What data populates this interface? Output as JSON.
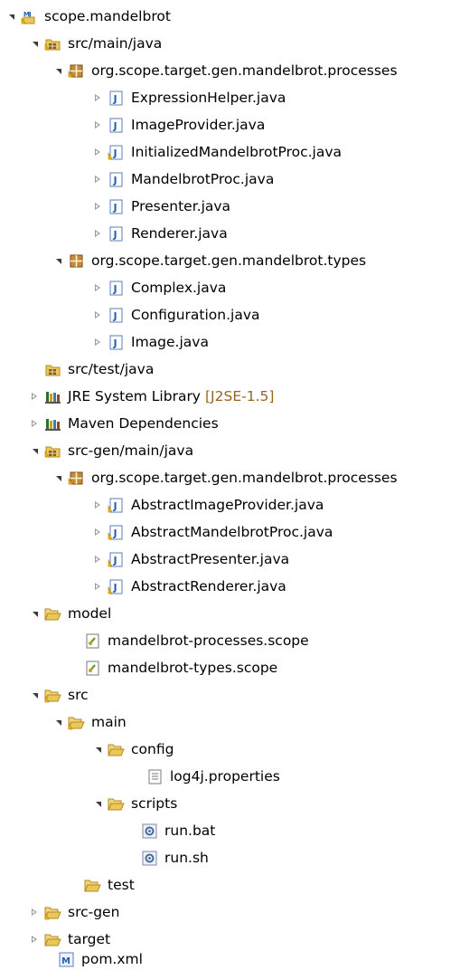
{
  "tree": {
    "project": "scope.mandelbrot",
    "src_main_java": {
      "label": "src/main/java",
      "pkg_processes": {
        "label": "org.scope.target.gen.mandelbrot.processes",
        "files": [
          "ExpressionHelper.java",
          "ImageProvider.java",
          "InitializedMandelbrotProc.java",
          "MandelbrotProc.java",
          "Presenter.java",
          "Renderer.java"
        ]
      },
      "pkg_types": {
        "label": "org.scope.target.gen.mandelbrot.types",
        "files": [
          "Complex.java",
          "Configuration.java",
          "Image.java"
        ]
      }
    },
    "src_test_java": "src/test/java",
    "jre": {
      "label": "JRE System Library",
      "decoration": "[J2SE-1.5]"
    },
    "maven": "Maven Dependencies",
    "src_gen_main_java": {
      "label": "src-gen/main/java",
      "pkg_processes": {
        "label": "org.scope.target.gen.mandelbrot.processes",
        "files": [
          "AbstractImageProvider.java",
          "AbstractMandelbrotProc.java",
          "AbstractPresenter.java",
          "AbstractRenderer.java"
        ]
      }
    },
    "model": {
      "label": "model",
      "files": [
        "mandelbrot-processes.scope",
        "mandelbrot-types.scope"
      ]
    },
    "src": {
      "label": "src",
      "main": {
        "label": "main",
        "config": {
          "label": "config",
          "files": [
            "log4j.properties"
          ]
        },
        "scripts": {
          "label": "scripts",
          "files": [
            "run.bat",
            "run.sh"
          ]
        }
      },
      "test": "test"
    },
    "src_gen": "src-gen",
    "target": "target",
    "pom": "pom.xml"
  },
  "colors": {
    "java_file": "#1f5fb4",
    "package": "#8a5a1a",
    "folder": "#e9c85a",
    "warning": "#f2b400",
    "decoration": "#95651f"
  }
}
